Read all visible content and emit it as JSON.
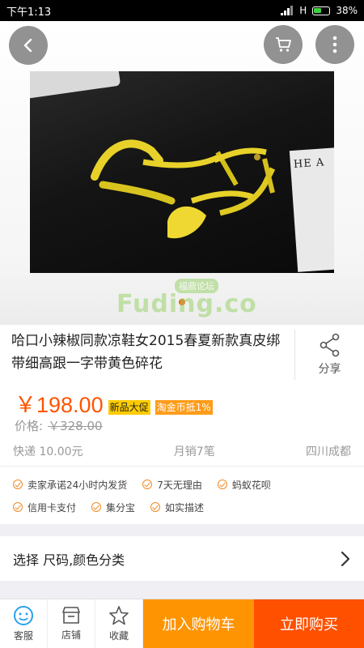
{
  "status_bar": {
    "time": "下午1:13",
    "network": "H",
    "battery": "38%"
  },
  "icons": {
    "back": "chevron-left-icon",
    "cart": "shopping-cart-icon",
    "more": "more-vertical-icon",
    "share": "share-icon",
    "service": "customer-service-icon",
    "shop": "shop-icon",
    "favorite": "star-icon",
    "sku": "chevron-right-icon",
    "check": "check-circle-icon"
  },
  "gallery": {
    "magazine_text": "HE A"
  },
  "watermark": {
    "main": "Fuding.co",
    "sub": "福鼎论坛"
  },
  "product": {
    "title": "哈口小辣椒同款凉鞋女2015春夏新款真皮绑带细高跟一字带黄色碎花",
    "share_label": "分享",
    "price": "￥198.00",
    "tags": [
      "新品大促",
      "淘金币抵1%"
    ],
    "original_price_label": "价格:",
    "original_price": "￥328.00",
    "shipping": "快递 10.00元",
    "monthly_sales": "月销7笔",
    "location": "四川成都"
  },
  "guarantees": [
    [
      "卖家承诺24小时内发货",
      "7天无理由",
      "蚂蚁花呗"
    ],
    [
      "信用卡支付",
      "集分宝",
      "如实描述"
    ]
  ],
  "sku": {
    "label": "选择 尺码,颜色分类"
  },
  "bottom_bar": {
    "service": "客服",
    "shop": "店铺",
    "favorite": "收藏",
    "add_to_cart": "加入购物车",
    "buy_now": "立即购买"
  },
  "colors": {
    "accent": "#ff5500",
    "add_cart_bg": "#ff9402",
    "buy_now_bg": "#ff5000",
    "tag_yellow": "#ffcc00",
    "tag_orange": "#ff9c1a"
  }
}
